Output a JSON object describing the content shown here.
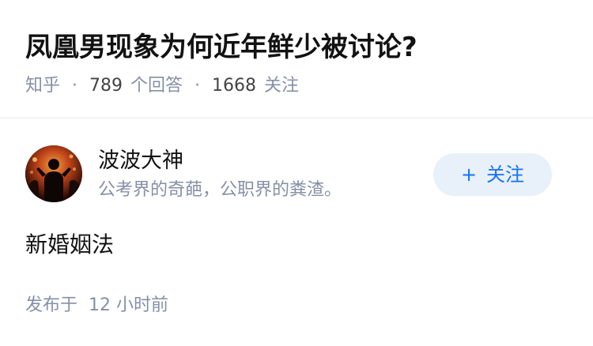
{
  "question": {
    "title": "凤凰男现象为何近年鲜少被讨论?",
    "source": "知乎",
    "answers_count": "789",
    "answers_label": "个回答",
    "followers_count": "1668",
    "followers_label": "关注",
    "separator": "·"
  },
  "author": {
    "name": "波波大神",
    "bio": "公考界的奇葩，公职界的粪渣。",
    "avatar_icon": "avatar-silhouette-fire",
    "follow_label": "关注",
    "follow_icon": "+"
  },
  "answer": {
    "content": "新婚姻法",
    "publish_prefix": "发布于",
    "publish_time": "12 小时前"
  },
  "colors": {
    "text_primary": "#121212",
    "text_secondary": "#8590a6",
    "accent": "#1772f6",
    "follow_bg": "#e8f0f9",
    "divider": "#ebebeb"
  }
}
